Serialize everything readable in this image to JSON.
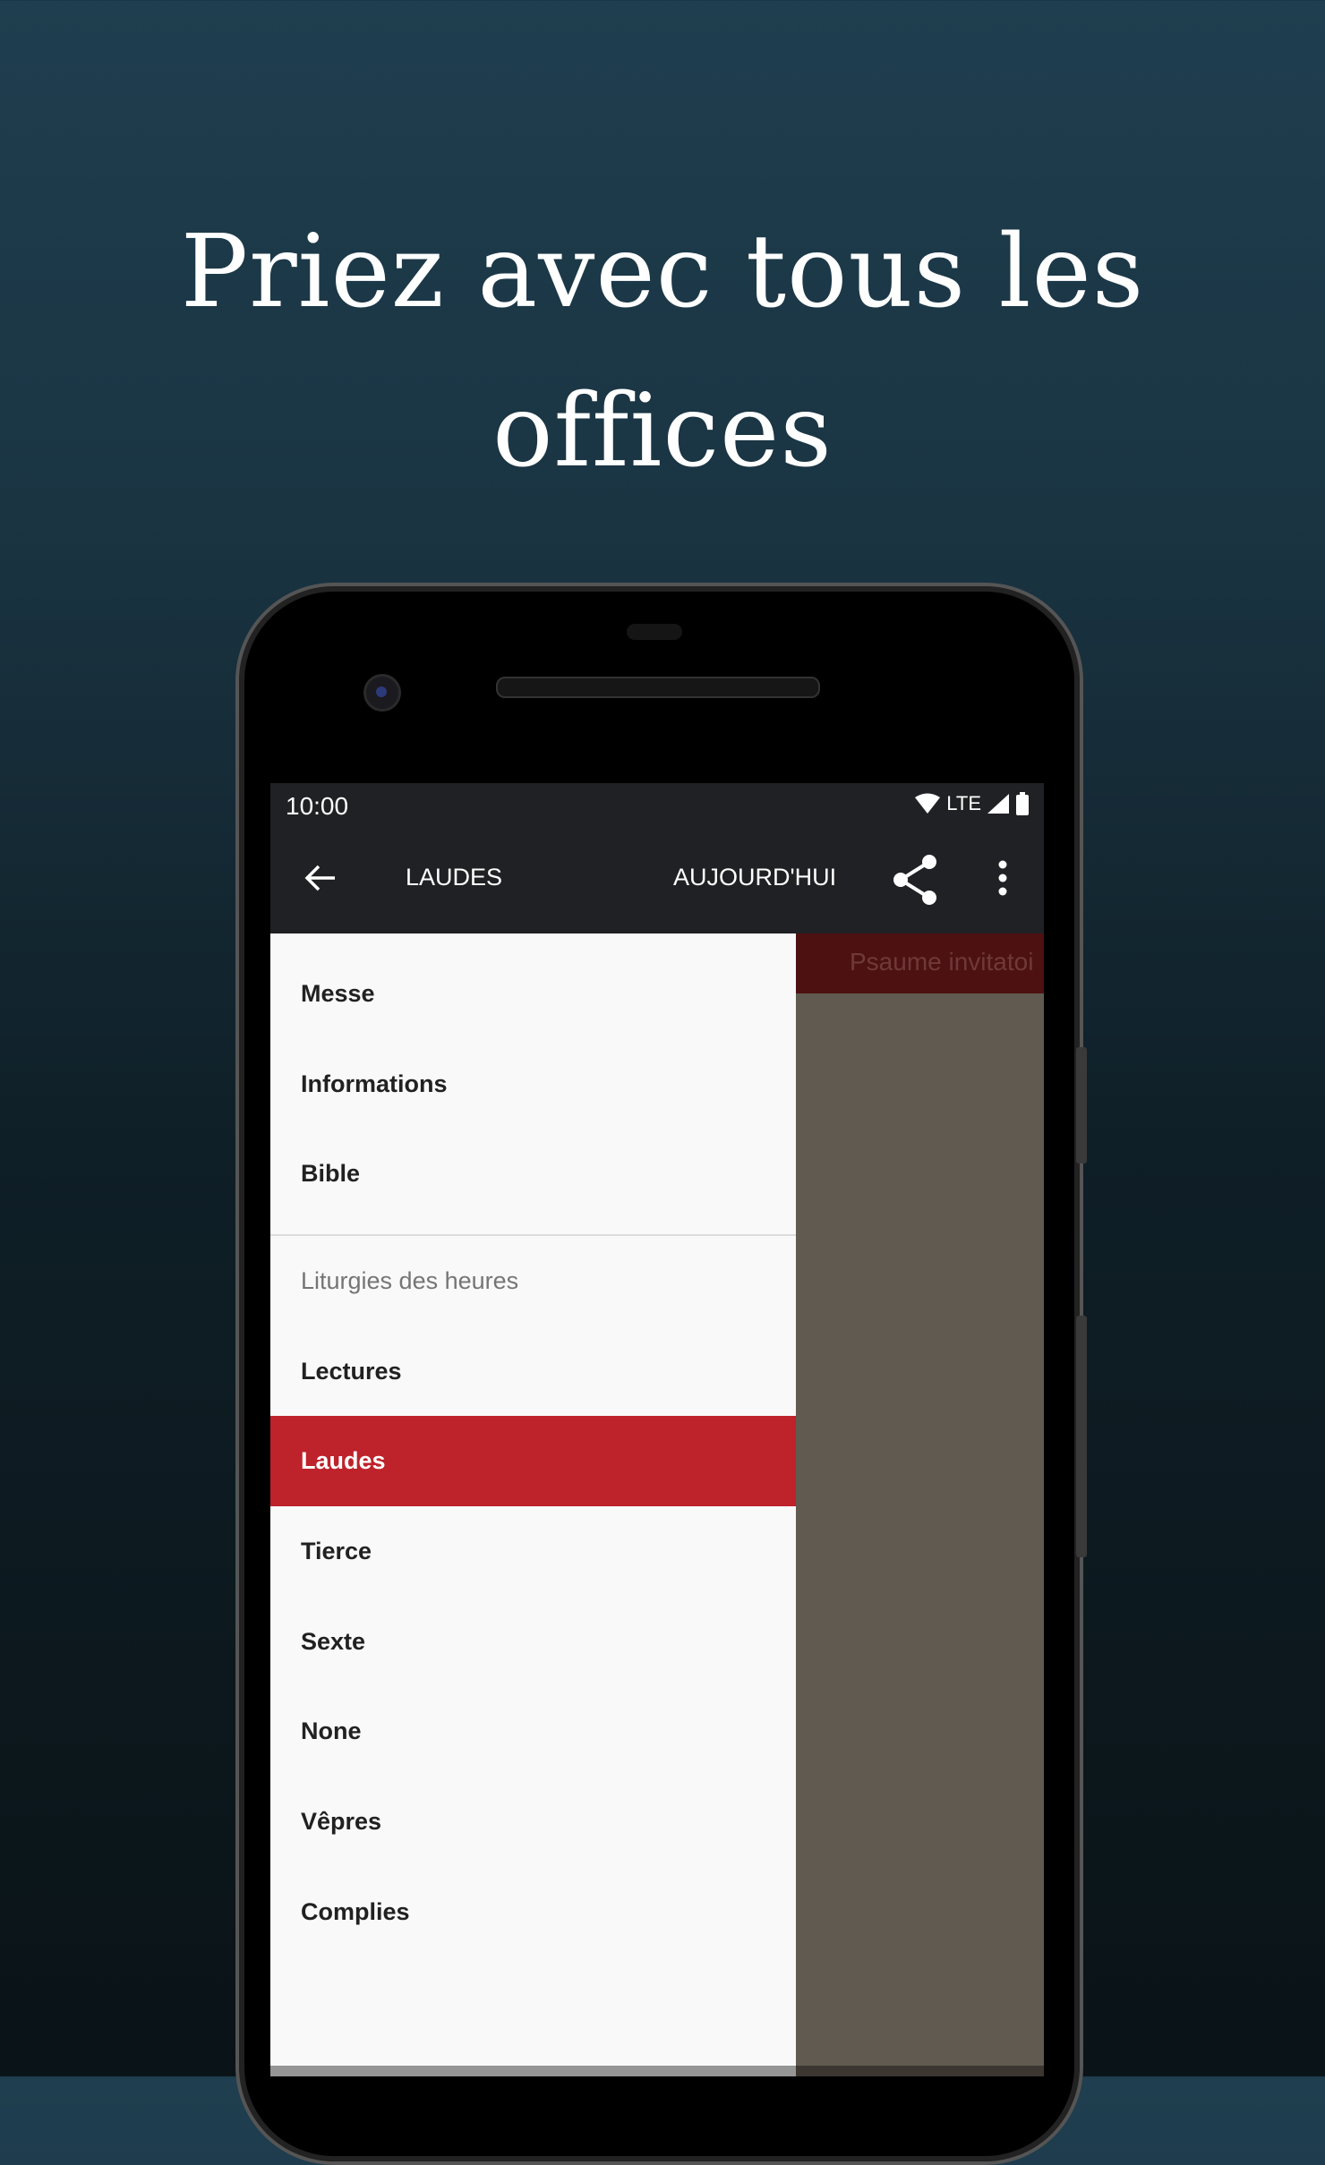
{
  "headline": {
    "line1": "Priez avec tous les",
    "line2": "offices"
  },
  "status_bar": {
    "time": "10:00",
    "network": "LTE",
    "icons": [
      "wifi-icon",
      "signal-icon",
      "battery-icon"
    ]
  },
  "toolbar": {
    "title": "LAUDES",
    "today_label": "AUJOURD'HUI",
    "icons": [
      "back-arrow-icon",
      "share-icon",
      "more-vert-icon"
    ]
  },
  "content": {
    "header": "Psaume invitatoi"
  },
  "drawer": {
    "items": [
      {
        "label": "Messe"
      },
      {
        "label": "Informations"
      },
      {
        "label": "Bible"
      }
    ],
    "section_title": "Liturgies des heures",
    "hours": [
      {
        "label": "Lectures",
        "active": false
      },
      {
        "label": "Laudes",
        "active": true
      },
      {
        "label": "Tierce",
        "active": false
      },
      {
        "label": "Sexte",
        "active": false
      },
      {
        "label": "None",
        "active": false
      },
      {
        "label": "Vêpres",
        "active": false
      },
      {
        "label": "Complies",
        "active": false
      }
    ]
  },
  "colors": {
    "accent": "#be222b",
    "toolbar": "#202124",
    "drawer": "#f9f9f9"
  }
}
